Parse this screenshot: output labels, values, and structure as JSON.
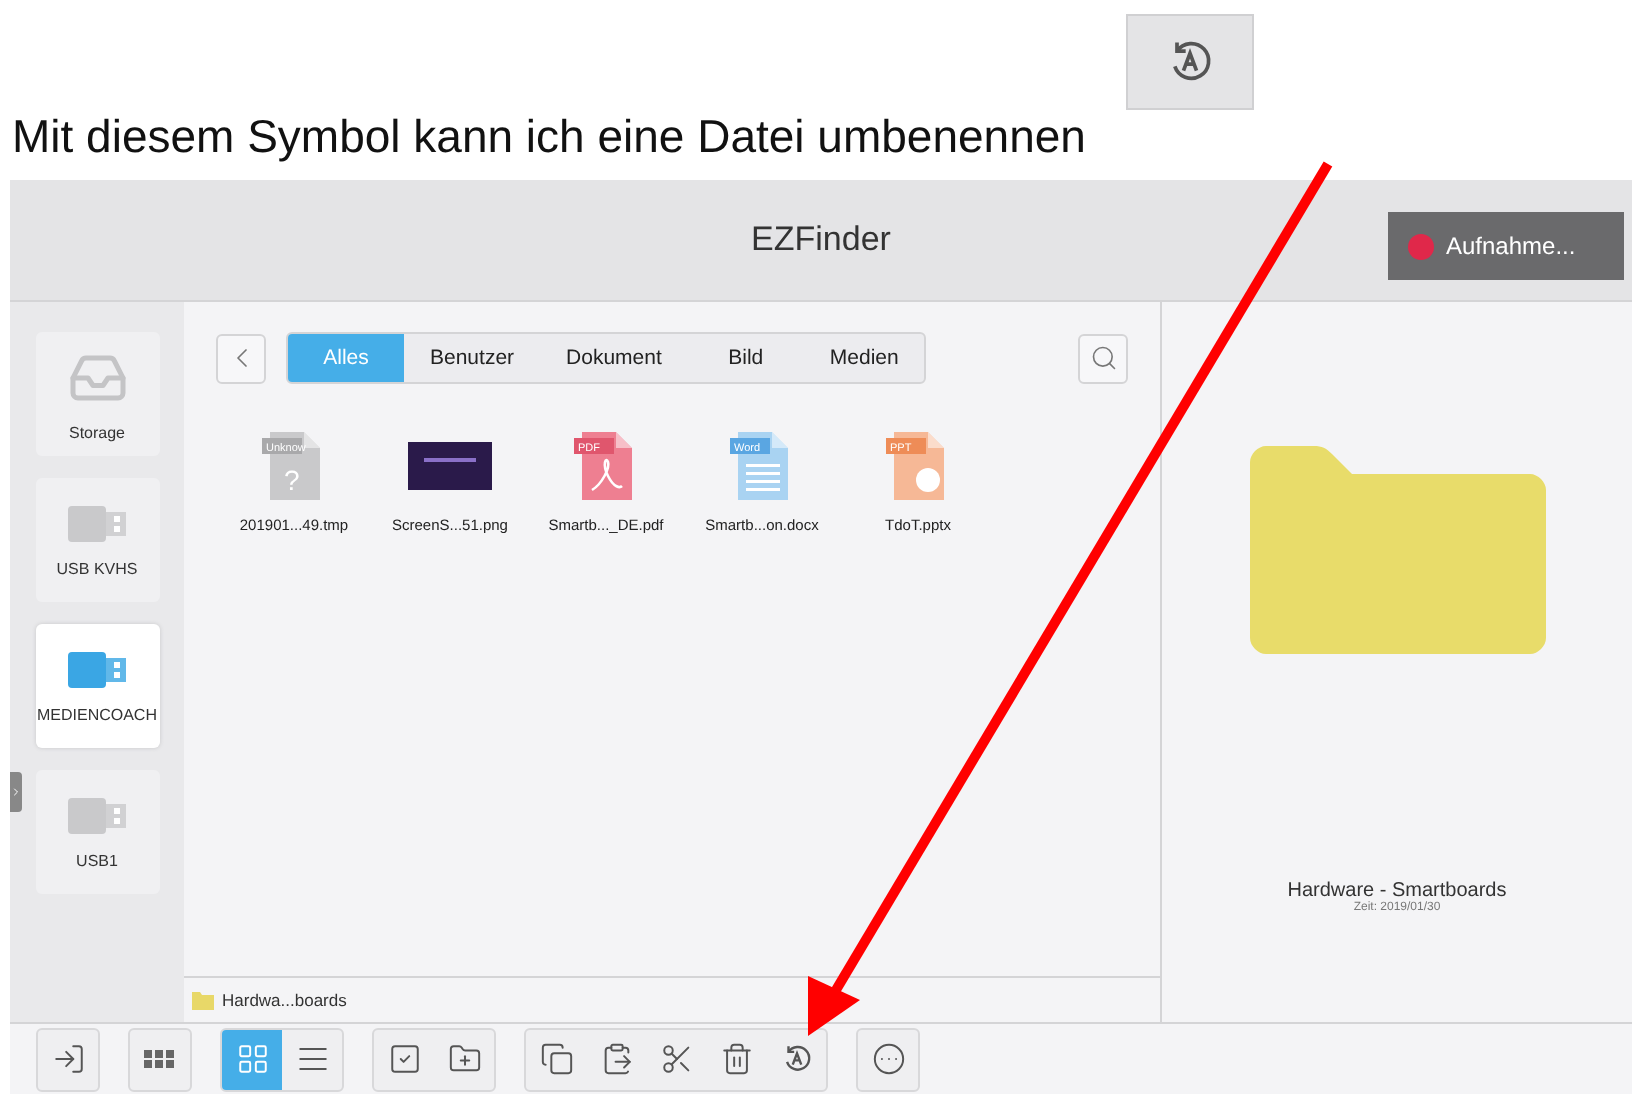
{
  "caption": {
    "text": "Mit diesem Symbol kann ich eine Datei umbenennen"
  },
  "window": {
    "title": "EZFinder"
  },
  "record_button": {
    "label": "Aufnahme..."
  },
  "sidebar": {
    "items": [
      {
        "label": "Storage",
        "kind": "storage",
        "selected": false
      },
      {
        "label": "USB KVHS",
        "kind": "usb",
        "selected": false
      },
      {
        "label": "MEDIENCOACH",
        "kind": "usb",
        "selected": true
      },
      {
        "label": "USB1",
        "kind": "usb",
        "selected": false
      }
    ]
  },
  "tabs": [
    {
      "label": "Alles",
      "selected": true
    },
    {
      "label": "Benutzer",
      "selected": false
    },
    {
      "label": "Dokument",
      "selected": false
    },
    {
      "label": "Bild",
      "selected": false
    },
    {
      "label": "Medien",
      "selected": false
    }
  ],
  "files": [
    {
      "name": "201901...49.tmp",
      "kind": "unknown",
      "badge": "Unknow",
      "glyph": "?"
    },
    {
      "name": "ScreenS...51.png",
      "kind": "image"
    },
    {
      "name": "Smartb..._DE.pdf",
      "kind": "pdf",
      "badge": "PDF"
    },
    {
      "name": "Smartb...on.docx",
      "kind": "word",
      "badge": "Word"
    },
    {
      "name": "TdoT.pptx",
      "kind": "ppt",
      "badge": "PPT"
    }
  ],
  "path": {
    "label": "Hardwa...boards"
  },
  "preview": {
    "name": "Hardware - Smartboards",
    "time": "Zeit: 2019/01/30"
  },
  "toolbar": {
    "groups": [
      {
        "buttons": [
          {
            "kind": "exit",
            "selected": false
          }
        ]
      },
      {
        "buttons": [
          {
            "kind": "apps",
            "selected": false
          }
        ]
      },
      {
        "buttons": [
          {
            "kind": "grid",
            "selected": true
          },
          {
            "kind": "list",
            "selected": false
          }
        ]
      },
      {
        "buttons": [
          {
            "kind": "select",
            "selected": false
          },
          {
            "kind": "newfolder",
            "selected": false
          }
        ]
      },
      {
        "buttons": [
          {
            "kind": "copy",
            "selected": false
          },
          {
            "kind": "paste",
            "selected": false
          },
          {
            "kind": "cut",
            "selected": false
          },
          {
            "kind": "delete",
            "selected": false
          },
          {
            "kind": "rename",
            "selected": false
          }
        ]
      },
      {
        "buttons": [
          {
            "kind": "more",
            "selected": false
          }
        ]
      }
    ]
  }
}
